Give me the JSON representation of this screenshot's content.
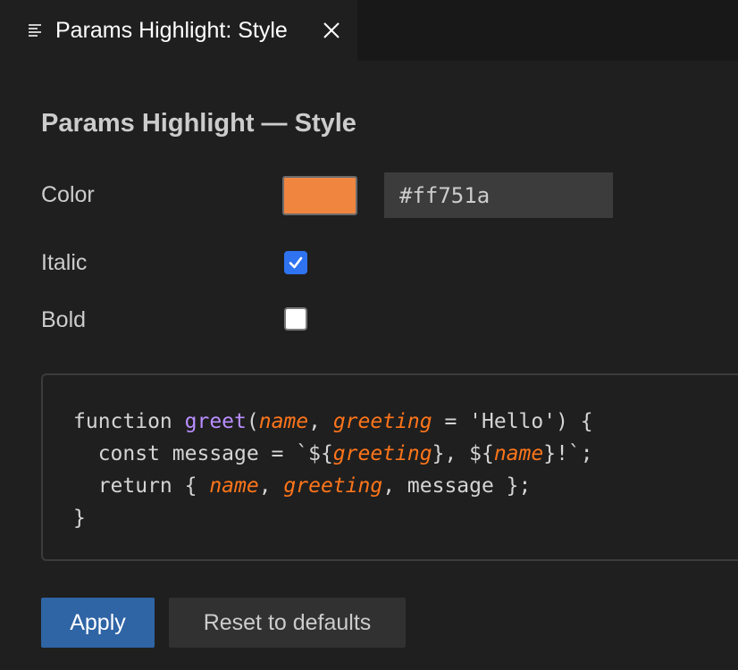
{
  "tab": {
    "title": "Params Highlight: Style",
    "icon": "preview-lines-icon",
    "close_icon": "close-icon"
  },
  "heading": "Params Highlight — Style",
  "color": {
    "label": "Color",
    "value": "#ff751a",
    "swatch_color": "#f08540"
  },
  "italic": {
    "label": "Italic",
    "checked": true
  },
  "bold": {
    "label": "Bold",
    "checked": false
  },
  "code_preview": {
    "lines": [
      [
        {
          "t": "function ",
          "k": "plain"
        },
        {
          "t": "greet",
          "k": "fn"
        },
        {
          "t": "(",
          "k": "plain"
        },
        {
          "t": "name",
          "k": "param"
        },
        {
          "t": ", ",
          "k": "plain"
        },
        {
          "t": "greeting",
          "k": "param"
        },
        {
          "t": " = 'Hello') {",
          "k": "plain"
        }
      ],
      [
        {
          "t": "  const message = `${",
          "k": "plain"
        },
        {
          "t": "greeting",
          "k": "param"
        },
        {
          "t": "}, ${",
          "k": "plain"
        },
        {
          "t": "name",
          "k": "param"
        },
        {
          "t": "}!`;",
          "k": "plain"
        }
      ],
      [
        {
          "t": "  return { ",
          "k": "plain"
        },
        {
          "t": "name",
          "k": "param"
        },
        {
          "t": ", ",
          "k": "plain"
        },
        {
          "t": "greeting",
          "k": "param"
        },
        {
          "t": ", message };",
          "k": "plain"
        }
      ],
      [
        {
          "t": "}",
          "k": "plain"
        }
      ]
    ]
  },
  "buttons": {
    "apply": "Apply",
    "reset": "Reset to defaults"
  },
  "colors": {
    "accent": "#2f64a5",
    "checkbox_checked": "#2f73f1",
    "param_highlight": "#ff751a",
    "function_name": "#b98eff"
  }
}
